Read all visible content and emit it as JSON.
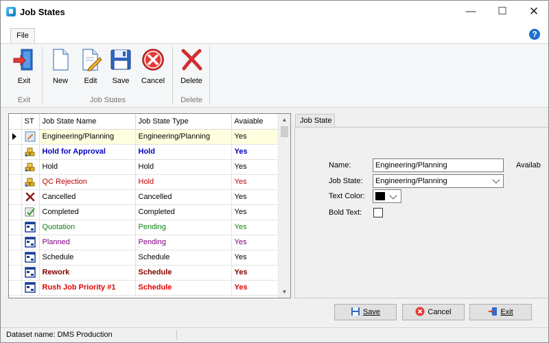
{
  "window": {
    "title": "Job States"
  },
  "ribbon": {
    "file_tab": "File",
    "groups": [
      {
        "label": "Exit",
        "buttons": [
          {
            "label": "Exit",
            "icon": "exit-door-icon"
          }
        ]
      },
      {
        "label": "Job States",
        "buttons": [
          {
            "label": "New",
            "icon": "new-document-icon"
          },
          {
            "label": "Edit",
            "icon": "edit-document-icon"
          },
          {
            "label": "Save",
            "icon": "floppy-disk-icon"
          },
          {
            "label": "Cancel",
            "icon": "cancel-circle-icon"
          }
        ]
      },
      {
        "label": "Delete",
        "buttons": [
          {
            "label": "Delete",
            "icon": "delete-x-icon"
          }
        ]
      }
    ]
  },
  "grid": {
    "columns": [
      "ST",
      "Job State Name",
      "Job State Type",
      "Avaiable"
    ],
    "rows": [
      {
        "icon": "document-edit-icon",
        "name": "Engineering/Planning",
        "type": "Engineering/Planning",
        "available": "Yes",
        "color": "#000000",
        "bold": false,
        "selected": true
      },
      {
        "icon": "gold-bars-icon",
        "name": "Hold for Approval",
        "type": "Hold",
        "available": "Yes",
        "color": "#0000c0",
        "bold": true,
        "selected": false
      },
      {
        "icon": "gold-bars-icon",
        "name": "Hold",
        "type": "Hold",
        "available": "Yes",
        "color": "#000000",
        "bold": false,
        "selected": false
      },
      {
        "icon": "gold-bars-icon",
        "name": "QC Rejection",
        "type": "Hold",
        "available": "Yes",
        "color": "#c00000",
        "bold": false,
        "selected": false
      },
      {
        "icon": "red-x-icon",
        "name": "Cancelled",
        "type": "Cancelled",
        "available": "Yes",
        "color": "#000000",
        "bold": false,
        "selected": false
      },
      {
        "icon": "checklist-icon",
        "name": "Completed",
        "type": "Completed",
        "available": "Yes",
        "color": "#000000",
        "bold": false,
        "selected": false
      },
      {
        "icon": "schedule-grid-icon",
        "name": "Quotation",
        "type": "Pending",
        "available": "Yes",
        "color": "#108010",
        "bold": false,
        "selected": false
      },
      {
        "icon": "schedule-grid-icon",
        "name": "Planned",
        "type": "Pending",
        "available": "Yes",
        "color": "#800080",
        "bold": false,
        "selected": false
      },
      {
        "icon": "schedule-grid-icon",
        "name": "Schedule",
        "type": "Schedule",
        "available": "Yes",
        "color": "#000000",
        "bold": false,
        "selected": false
      },
      {
        "icon": "schedule-grid-icon",
        "name": "Rework",
        "type": "Schedule",
        "available": "Yes",
        "color": "#800000",
        "bold": true,
        "selected": false
      },
      {
        "icon": "schedule-grid-icon",
        "name": "Rush Job Priority #1",
        "type": "Schedule",
        "available": "Yes",
        "color": "#e00000",
        "bold": true,
        "selected": false
      }
    ]
  },
  "detail": {
    "tab": "Job State",
    "name_label": "Name:",
    "name_value": "Engineering/Planning",
    "available_label": "Availab",
    "state_label": "Job State:",
    "state_value": "Engineering/Planning",
    "color_label": "Text Color:",
    "color_value": "#000000",
    "bold_label": "Bold Text:",
    "bold_checked": false
  },
  "buttons": {
    "save": "Save",
    "cancel": "Cancel",
    "exit": "Exit"
  },
  "status": {
    "dataset": "Dataset name:  DMS Production"
  }
}
